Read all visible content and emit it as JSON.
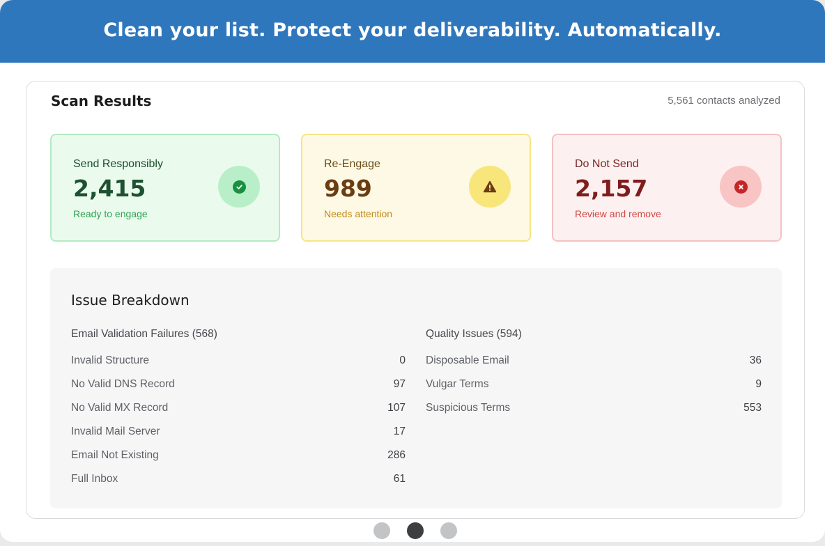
{
  "banner": {
    "title": "Clean your list. Protect your deliverability. Automatically."
  },
  "scan": {
    "title": "Scan Results",
    "summary": "5,561 contacts analyzed"
  },
  "cards": [
    {
      "label": "Send Responsibly",
      "value": "2,415",
      "sub": "Ready to engage",
      "icon": "check-circle-icon",
      "color": "#19903d"
    },
    {
      "label": "Re-Engage",
      "value": "989",
      "sub": "Needs attention",
      "icon": "warning-triangle-icon",
      "color": "#6a3d12"
    },
    {
      "label": "Do Not Send",
      "value": "2,157",
      "sub": "Review and remove",
      "icon": "x-circle-icon",
      "color": "#c42626"
    }
  ],
  "issues": {
    "title": "Issue Breakdown",
    "left": {
      "heading": "Email Validation Failures (568)",
      "rows": [
        {
          "label": "Invalid Structure",
          "value": "0"
        },
        {
          "label": "No Valid DNS Record",
          "value": "97"
        },
        {
          "label": "No Valid MX Record",
          "value": "107"
        },
        {
          "label": "Invalid Mail Server",
          "value": "17"
        },
        {
          "label": "Email Not Existing",
          "value": "286"
        },
        {
          "label": "Full Inbox",
          "value": "61"
        }
      ]
    },
    "right": {
      "heading": "Quality Issues (594)",
      "rows": [
        {
          "label": "Disposable Email",
          "value": "36"
        },
        {
          "label": "Vulgar Terms",
          "value": "9"
        },
        {
          "label": "Suspicious Terms",
          "value": "553"
        }
      ]
    }
  },
  "pager": {
    "count": 3,
    "active_index": 1
  }
}
